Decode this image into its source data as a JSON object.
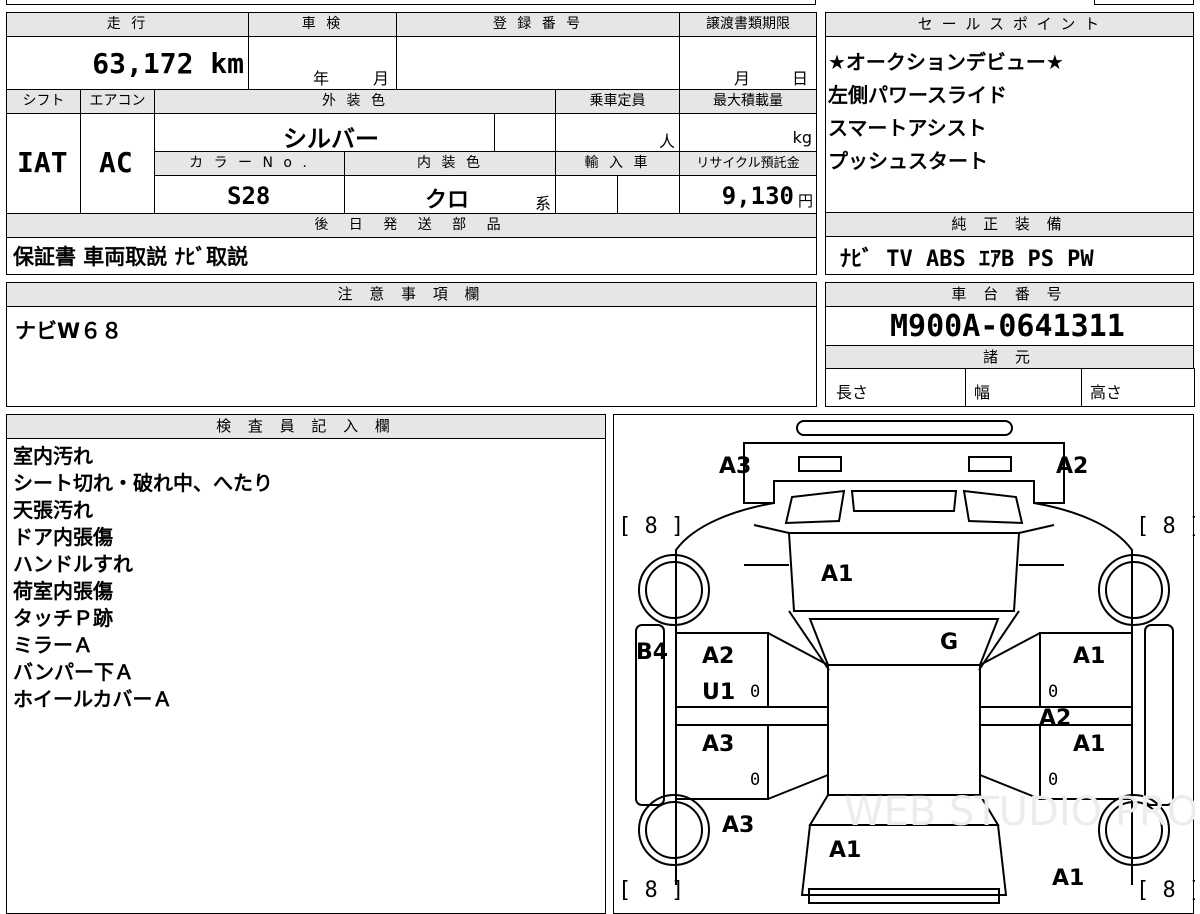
{
  "headers": {
    "mileage": "走 行",
    "inspection": "車 検",
    "registration": "登 録 番 号",
    "transfer_deadline": "譲渡書類期限",
    "sales_points": "セ ー ル ス ポ イ ン ト",
    "shift": "シフト",
    "aircon": "エアコン",
    "exterior_color": "外 装 色",
    "capacity": "乗車定員",
    "max_load": "最大積載量",
    "color_no": "カ ラ ー N o .",
    "interior_color": "内 装 色",
    "import": "輸 入 車",
    "recycle": "リサイクル預託金",
    "later_parts": "後 日 発 送 部 品",
    "factory_equipment": "純 正 装 備",
    "notes": "注 意 事 項 欄",
    "chassis": "車 台 番 号",
    "specs": "諸 元",
    "inspector": "検 査 員 記 入 欄"
  },
  "values": {
    "mileage": "63,172 km",
    "inspection_year": "年",
    "inspection_month": "月",
    "transfer_month": "月",
    "transfer_day": "日",
    "shift": "IAT",
    "aircon": "AC",
    "exterior_color": "シルバー",
    "capacity_unit": "人",
    "load_unit": "kg",
    "color_no": "S28",
    "interior_color": "クロ",
    "interior_suffix": "系",
    "recycle_amount": "9,130",
    "recycle_unit": "円",
    "later_parts": "保証書 車両取説 ﾅﾋﾞ取説",
    "factory_equipment": "ﾅﾋﾞ TV ABS ｴｱB PS PW",
    "notes": "ナビW６８",
    "chassis": "M900A-0641311",
    "length_label": "長さ",
    "width_label": "幅",
    "height_label": "高さ"
  },
  "sales_points": [
    "★オークションデビュー★",
    "左側パワースライド",
    "スマートアシスト",
    "プッシュスタート"
  ],
  "inspector_notes": [
    "室内汚れ",
    "シート切れ・破れ中、へたり",
    "天張汚れ",
    "ドア内張傷",
    "ハンドルすれ",
    "荷室内張傷",
    "タッチＰ跡",
    "ミラーＡ",
    "バンパー下Ａ",
    "ホイールカバーＡ"
  ],
  "diagram": {
    "marks": {
      "front_left": "A3",
      "front_right": "A2",
      "bonnet": "A1",
      "windshield": "G",
      "left_fender": "B4",
      "left_front_door": "A2",
      "left_front_door_2": "U1",
      "left_rear_door": "A3",
      "left_rear_quarter": "A3",
      "rear_hatch": "A1",
      "right_front_door": "A1",
      "right_center": "A2",
      "right_rear_door": "A1",
      "right_rear": "A1"
    },
    "tread": {
      "front_left": "[ 8 ]",
      "front_right": "[ 8 ]",
      "rear_left": "[ 8 ]",
      "rear_right": "[ 8 ]"
    },
    "zeros": "0",
    "watermark": "WEB STUDIO PRO"
  }
}
